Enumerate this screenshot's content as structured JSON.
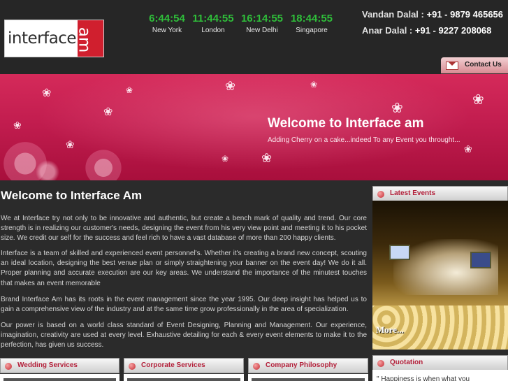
{
  "logo": {
    "word1": "interface",
    "word2": "am"
  },
  "clocks": [
    {
      "time": "6:44:54",
      "city": "New York"
    },
    {
      "time": "11:44:55",
      "city": "London"
    },
    {
      "time": "16:14:55",
      "city": "New Delhi"
    },
    {
      "time": "18:44:55",
      "city": "Singapore"
    }
  ],
  "contacts": [
    {
      "name": "Vandan Dalal :",
      "phone": "+91 - 9879 465656"
    },
    {
      "name": "Anar Dalal :",
      "phone": "+91 - 9227 208068"
    }
  ],
  "contact_button": {
    "label": "Contact Us"
  },
  "banner": {
    "title": "Welcome to Interface am",
    "subtitle": "Adding Cherry on a cake...indeed To any Event you throught..."
  },
  "main": {
    "title": "Welcome to Interface Am",
    "paragraphs": [
      "We at Interface try not only to be innovative and authentic, but create a bench mark of quality and trend. Our core strength is in realizing our customer's needs, designing the event from his very view point and meeting it to his pocket size. We credit our self for the success and feel rich to have a vast database of more than 200 happy clients.",
      "Interface is a team of skilled and experienced event personnel's. Whether it's creating a brand new concept, scouting an ideal location, designing the best venue plan or simply straightening your banner on the event day! We do it all. Proper planning and accurate execution are our key areas. We understand the importance of the minutest touches that makes an event memorable",
      "Brand Interface Am has its roots in the event management since the year 1995. Our deep insight has helped us to gain a comprehensive view of the industry and at the same time grow professionally in the area of specialization.",
      "Our power is based on a world class standard of Event Designing, Planning and Management. Our experience, imagination, creativity are used at every level. Exhaustive detailing for each & every event elements to make it to the perfection, has given us success."
    ]
  },
  "sidebar": {
    "latest_events": {
      "title": "Latest Events",
      "more": "More..."
    },
    "quotation": {
      "title": "Quotation",
      "text": "\" Happiness is when what you"
    }
  },
  "services": [
    {
      "title": "Wedding Services"
    },
    {
      "title": "Corporate Services"
    },
    {
      "title": "Company Philosophy"
    }
  ],
  "colors": {
    "accent": "#c21d4f",
    "clock_green": "#2fbf3a",
    "panel_title": "#b3203a"
  }
}
